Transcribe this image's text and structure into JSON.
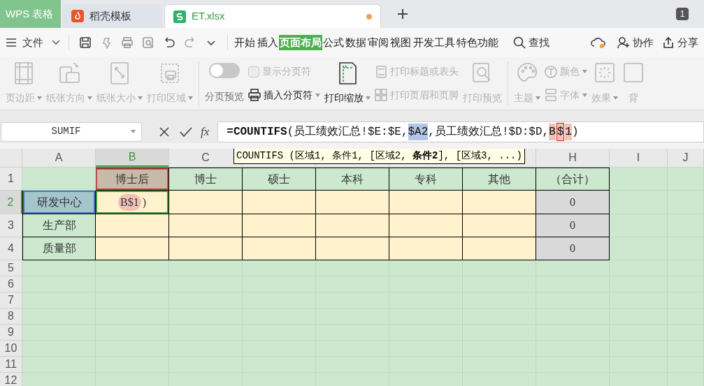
{
  "tabs": [
    {
      "label": "WPS 表格",
      "kind": "home",
      "selected": false
    },
    {
      "label": "稻壳模板",
      "kind": "docer",
      "selected": false
    },
    {
      "label": "ET.xlsx",
      "kind": "sheet",
      "selected": true,
      "modified": true
    }
  ],
  "window_badge": "1",
  "menu": {
    "file": "文件",
    "tabs": [
      {
        "label": "开始",
        "selected": false
      },
      {
        "label": "插入",
        "selected": false
      },
      {
        "label": "页面布局",
        "selected": true
      },
      {
        "label": "公式",
        "selected": false
      },
      {
        "label": "数据",
        "selected": false
      },
      {
        "label": "审阅",
        "selected": false
      },
      {
        "label": "视图",
        "selected": false
      },
      {
        "label": "开发工具",
        "selected": false
      },
      {
        "label": "特色功能",
        "selected": false
      }
    ],
    "search": "查找",
    "collab": "协作",
    "share": "分享"
  },
  "ribbon": {
    "groups": [
      [
        {
          "kind": "big",
          "label": "页边距",
          "dropdown": true,
          "disabled": true
        },
        {
          "kind": "big",
          "label": "纸张方向",
          "dropdown": true,
          "disabled": true
        },
        {
          "kind": "big",
          "label": "纸张大小",
          "dropdown": true,
          "disabled": true
        },
        {
          "kind": "big",
          "label": "打印区域",
          "dropdown": true,
          "disabled": true
        }
      ],
      [
        {
          "kind": "toggle",
          "label": "分页预览",
          "on": false
        },
        {
          "kind": "stack",
          "items": [
            {
              "kind": "check",
              "label": "显示分页符",
              "checked": false,
              "disabled": true
            },
            {
              "kind": "small",
              "label": "插入分页符",
              "dropdown": true,
              "disabled": false
            }
          ]
        },
        {
          "kind": "big",
          "label": "打印缩放",
          "dropdown": true,
          "disabled": false
        },
        {
          "kind": "stack",
          "items": [
            {
              "kind": "small",
              "label": "打印标题或表头",
              "dropdown": false,
              "disabled": true
            },
            {
              "kind": "small",
              "label": "打印页眉和页脚",
              "dropdown": false,
              "disabled": true
            }
          ]
        },
        {
          "kind": "big",
          "label": "打印预览",
          "dropdown": false,
          "disabled": true
        }
      ],
      [
        {
          "kind": "big",
          "label": "主题",
          "dropdown": true,
          "disabled": true
        },
        {
          "kind": "stack",
          "items": [
            {
              "kind": "small",
              "label": "颜色",
              "dropdown": true,
              "disabled": true
            },
            {
              "kind": "small",
              "label": "字体",
              "dropdown": true,
              "disabled": true
            }
          ]
        },
        {
          "kind": "big",
          "label": "效果",
          "dropdown": true,
          "disabled": true
        },
        {
          "kind": "big",
          "label": "背",
          "dropdown": false,
          "disabled": true
        }
      ]
    ]
  },
  "name_box": "SUMIF",
  "fx_label": "fx",
  "formula": [
    {
      "text": "=COUNTIFS",
      "kind": "bold"
    },
    {
      "text": "(员工绩效汇总!$E:$E,",
      "kind": "plain"
    },
    {
      "text": "$A2",
      "kind": "ref",
      "color": "#b4c6e7"
    },
    {
      "text": ",员工绩效汇总!$D:$D,",
      "kind": "plain"
    },
    {
      "text": "B",
      "kind": "ref",
      "color": "#f2c2b8"
    },
    {
      "text": "$",
      "kind": "caret",
      "color": "#f2c2b8"
    },
    {
      "text": "1",
      "kind": "ref",
      "color": "#f2c2b8"
    },
    {
      "text": ")",
      "kind": "plain"
    }
  ],
  "tooltip": "COUNTIFS (区域1, 条件1, [区域2, **条件2**], [区域3, ...)",
  "sheet": {
    "columns": [
      {
        "letter": "A",
        "selected": false
      },
      {
        "letter": "B",
        "selected": true
      },
      {
        "letter": "C",
        "selected": false
      },
      {
        "letter": "H",
        "selected": false
      },
      {
        "letter": "I",
        "selected": false
      },
      {
        "letter": "J",
        "selected": false
      }
    ],
    "rows": [
      {
        "number": "1",
        "selected": false,
        "cells": [
          {
            "kind": "blank"
          },
          {
            "kind": "header",
            "text": "博士后",
            "color": "#c0504d"
          },
          {
            "kind": "header",
            "text": "博士"
          },
          {
            "kind": "header",
            "text": "硕士"
          },
          {
            "kind": "header",
            "text": "本科"
          },
          {
            "kind": "header",
            "text": "专科"
          },
          {
            "kind": "header",
            "text": "其他"
          },
          {
            "kind": "header",
            "text": "（合计）"
          },
          {
            "kind": "blank"
          },
          {
            "kind": "blank"
          }
        ]
      },
      {
        "number": "2",
        "selected": true,
        "cells": [
          {
            "kind": "label",
            "text": "研发中心",
            "color": "#4472c4"
          },
          {
            "kind": "input",
            "active": true,
            "ref": {
              "text": "B$1",
              "color": "#f2c2b8"
            },
            "text": ")"
          },
          {
            "kind": "input"
          },
          {
            "kind": "input"
          },
          {
            "kind": "input"
          },
          {
            "kind": "input"
          },
          {
            "kind": "input"
          },
          {
            "kind": "total",
            "text": "0"
          },
          {
            "kind": "blank"
          },
          {
            "kind": "blank"
          }
        ]
      },
      {
        "number": "3",
        "selected": false,
        "cells": [
          {
            "kind": "label",
            "text": "生产部"
          },
          {
            "kind": "input"
          },
          {
            "kind": "input"
          },
          {
            "kind": "input"
          },
          {
            "kind": "input"
          },
          {
            "kind": "input"
          },
          {
            "kind": "input"
          },
          {
            "kind": "total",
            "text": "0"
          },
          {
            "kind": "blank"
          },
          {
            "kind": "blank"
          }
        ]
      },
      {
        "number": "4",
        "selected": false,
        "cells": [
          {
            "kind": "label",
            "text": "质量部"
          },
          {
            "kind": "input"
          },
          {
            "kind": "input"
          },
          {
            "kind": "input"
          },
          {
            "kind": "input"
          },
          {
            "kind": "input"
          },
          {
            "kind": "input"
          },
          {
            "kind": "total",
            "text": "0"
          },
          {
            "kind": "blank"
          },
          {
            "kind": "blank"
          }
        ]
      },
      {
        "number": "5",
        "selected": false
      },
      {
        "number": "6",
        "selected": false
      },
      {
        "number": "7",
        "selected": false
      },
      {
        "number": "8",
        "selected": false
      },
      {
        "number": "9",
        "selected": false
      },
      {
        "number": "10",
        "selected": false
      },
      {
        "number": "11",
        "selected": false
      },
      {
        "number": "12",
        "selected": false
      }
    ]
  }
}
